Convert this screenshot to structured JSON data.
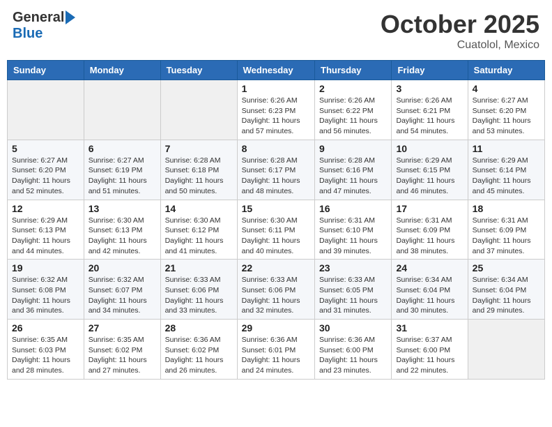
{
  "logo": {
    "general": "General",
    "blue": "Blue"
  },
  "header": {
    "month": "October 2025",
    "location": "Cuatolol, Mexico"
  },
  "weekdays": [
    "Sunday",
    "Monday",
    "Tuesday",
    "Wednesday",
    "Thursday",
    "Friday",
    "Saturday"
  ],
  "weeks": [
    [
      {
        "day": "",
        "info": ""
      },
      {
        "day": "",
        "info": ""
      },
      {
        "day": "",
        "info": ""
      },
      {
        "day": "1",
        "info": "Sunrise: 6:26 AM\nSunset: 6:23 PM\nDaylight: 11 hours and 57 minutes."
      },
      {
        "day": "2",
        "info": "Sunrise: 6:26 AM\nSunset: 6:22 PM\nDaylight: 11 hours and 56 minutes."
      },
      {
        "day": "3",
        "info": "Sunrise: 6:26 AM\nSunset: 6:21 PM\nDaylight: 11 hours and 54 minutes."
      },
      {
        "day": "4",
        "info": "Sunrise: 6:27 AM\nSunset: 6:20 PM\nDaylight: 11 hours and 53 minutes."
      }
    ],
    [
      {
        "day": "5",
        "info": "Sunrise: 6:27 AM\nSunset: 6:20 PM\nDaylight: 11 hours and 52 minutes."
      },
      {
        "day": "6",
        "info": "Sunrise: 6:27 AM\nSunset: 6:19 PM\nDaylight: 11 hours and 51 minutes."
      },
      {
        "day": "7",
        "info": "Sunrise: 6:28 AM\nSunset: 6:18 PM\nDaylight: 11 hours and 50 minutes."
      },
      {
        "day": "8",
        "info": "Sunrise: 6:28 AM\nSunset: 6:17 PM\nDaylight: 11 hours and 48 minutes."
      },
      {
        "day": "9",
        "info": "Sunrise: 6:28 AM\nSunset: 6:16 PM\nDaylight: 11 hours and 47 minutes."
      },
      {
        "day": "10",
        "info": "Sunrise: 6:29 AM\nSunset: 6:15 PM\nDaylight: 11 hours and 46 minutes."
      },
      {
        "day": "11",
        "info": "Sunrise: 6:29 AM\nSunset: 6:14 PM\nDaylight: 11 hours and 45 minutes."
      }
    ],
    [
      {
        "day": "12",
        "info": "Sunrise: 6:29 AM\nSunset: 6:13 PM\nDaylight: 11 hours and 44 minutes."
      },
      {
        "day": "13",
        "info": "Sunrise: 6:30 AM\nSunset: 6:13 PM\nDaylight: 11 hours and 42 minutes."
      },
      {
        "day": "14",
        "info": "Sunrise: 6:30 AM\nSunset: 6:12 PM\nDaylight: 11 hours and 41 minutes."
      },
      {
        "day": "15",
        "info": "Sunrise: 6:30 AM\nSunset: 6:11 PM\nDaylight: 11 hours and 40 minutes."
      },
      {
        "day": "16",
        "info": "Sunrise: 6:31 AM\nSunset: 6:10 PM\nDaylight: 11 hours and 39 minutes."
      },
      {
        "day": "17",
        "info": "Sunrise: 6:31 AM\nSunset: 6:09 PM\nDaylight: 11 hours and 38 minutes."
      },
      {
        "day": "18",
        "info": "Sunrise: 6:31 AM\nSunset: 6:09 PM\nDaylight: 11 hours and 37 minutes."
      }
    ],
    [
      {
        "day": "19",
        "info": "Sunrise: 6:32 AM\nSunset: 6:08 PM\nDaylight: 11 hours and 36 minutes."
      },
      {
        "day": "20",
        "info": "Sunrise: 6:32 AM\nSunset: 6:07 PM\nDaylight: 11 hours and 34 minutes."
      },
      {
        "day": "21",
        "info": "Sunrise: 6:33 AM\nSunset: 6:06 PM\nDaylight: 11 hours and 33 minutes."
      },
      {
        "day": "22",
        "info": "Sunrise: 6:33 AM\nSunset: 6:06 PM\nDaylight: 11 hours and 32 minutes."
      },
      {
        "day": "23",
        "info": "Sunrise: 6:33 AM\nSunset: 6:05 PM\nDaylight: 11 hours and 31 minutes."
      },
      {
        "day": "24",
        "info": "Sunrise: 6:34 AM\nSunset: 6:04 PM\nDaylight: 11 hours and 30 minutes."
      },
      {
        "day": "25",
        "info": "Sunrise: 6:34 AM\nSunset: 6:04 PM\nDaylight: 11 hours and 29 minutes."
      }
    ],
    [
      {
        "day": "26",
        "info": "Sunrise: 6:35 AM\nSunset: 6:03 PM\nDaylight: 11 hours and 28 minutes."
      },
      {
        "day": "27",
        "info": "Sunrise: 6:35 AM\nSunset: 6:02 PM\nDaylight: 11 hours and 27 minutes."
      },
      {
        "day": "28",
        "info": "Sunrise: 6:36 AM\nSunset: 6:02 PM\nDaylight: 11 hours and 26 minutes."
      },
      {
        "day": "29",
        "info": "Sunrise: 6:36 AM\nSunset: 6:01 PM\nDaylight: 11 hours and 24 minutes."
      },
      {
        "day": "30",
        "info": "Sunrise: 6:36 AM\nSunset: 6:00 PM\nDaylight: 11 hours and 23 minutes."
      },
      {
        "day": "31",
        "info": "Sunrise: 6:37 AM\nSunset: 6:00 PM\nDaylight: 11 hours and 22 minutes."
      },
      {
        "day": "",
        "info": ""
      }
    ]
  ]
}
